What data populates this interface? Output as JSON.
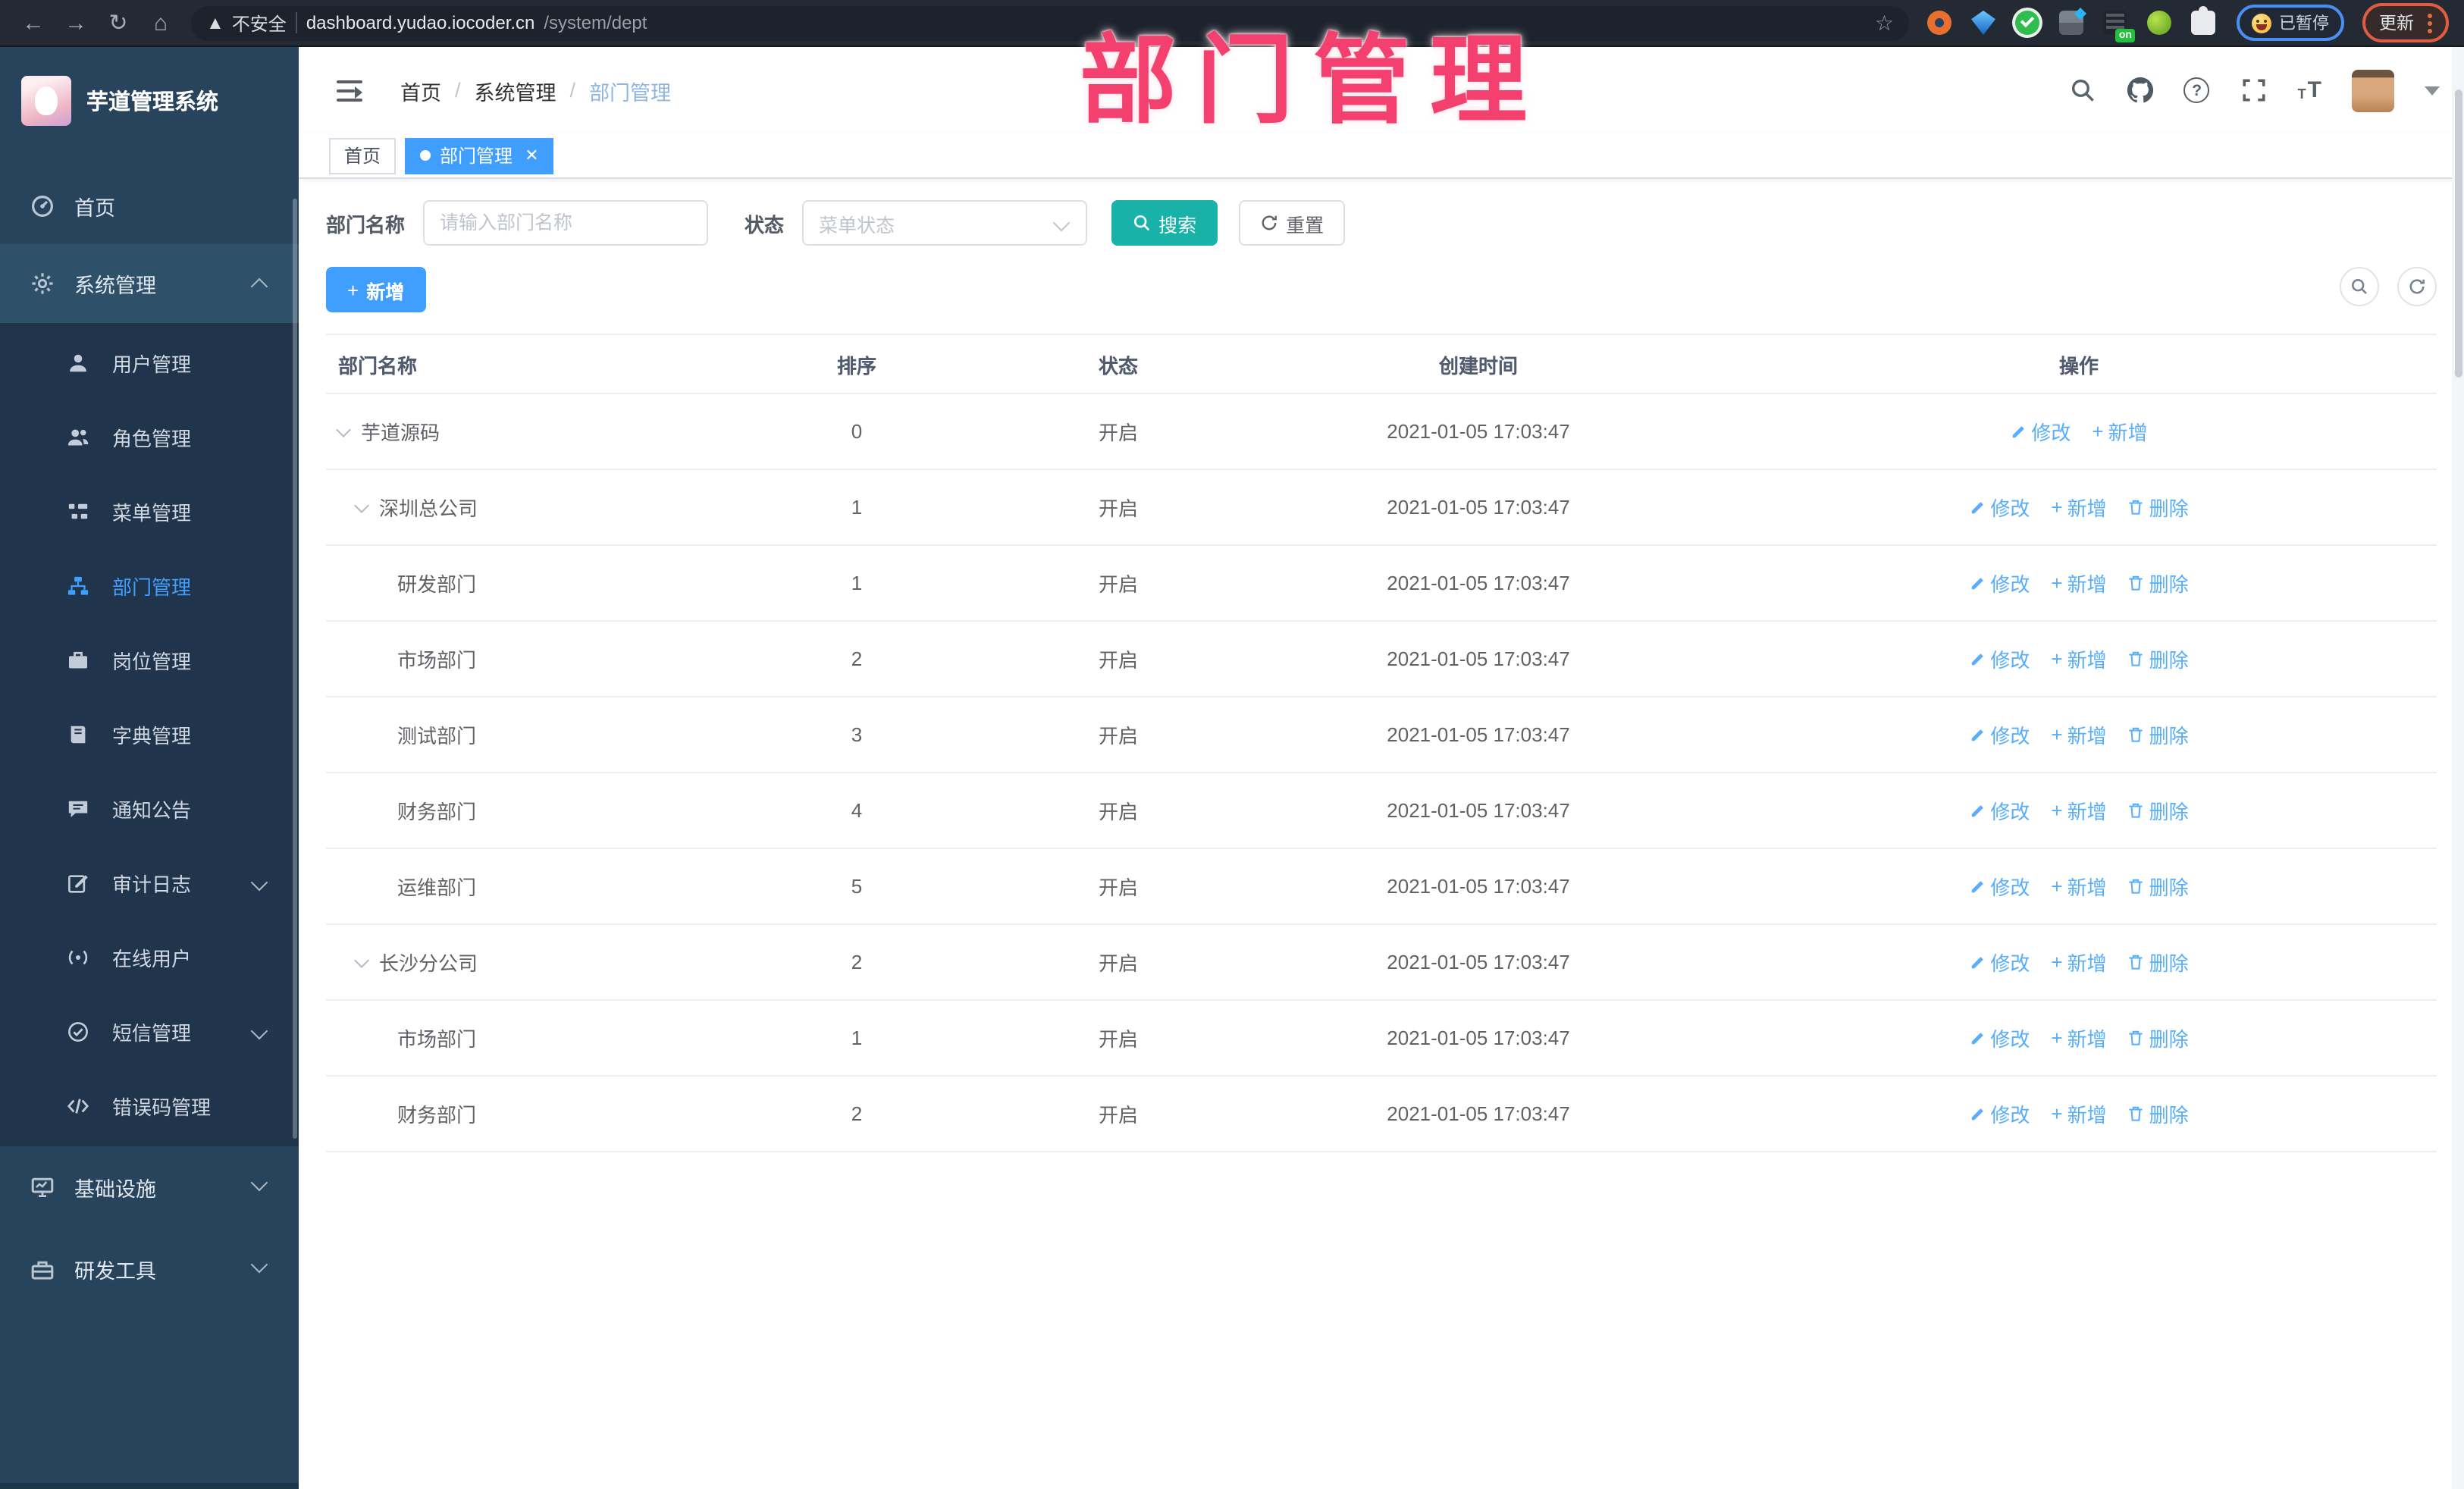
{
  "browser": {
    "security_warning": "不安全",
    "url_host": "dashboard.yudao.iocoder.cn",
    "url_path": "/system/dept",
    "extension_badge": "on",
    "paused_badge": "已暂停",
    "update_button": "更新"
  },
  "app": {
    "logo_title": "芋道管理系统",
    "overlay_title": "部门管理",
    "breadcrumb": [
      "首页",
      "系统管理",
      "部门管理"
    ],
    "tabs": [
      {
        "label": "首页",
        "active": false
      },
      {
        "label": "部门管理",
        "active": true
      }
    ]
  },
  "sidebar": {
    "items": [
      {
        "label": "首页",
        "icon": "home-icon"
      },
      {
        "label": "系统管理",
        "icon": "gear-icon",
        "state": "expanded"
      },
      {
        "label": "用户管理",
        "icon": "user-icon"
      },
      {
        "label": "角色管理",
        "icon": "users-icon"
      },
      {
        "label": "菜单管理",
        "icon": "menu-tree-icon"
      },
      {
        "label": "部门管理",
        "icon": "org-chart-icon",
        "state": "active"
      },
      {
        "label": "岗位管理",
        "icon": "briefcase-icon"
      },
      {
        "label": "字典管理",
        "icon": "dictionary-icon"
      },
      {
        "label": "通知公告",
        "icon": "announcement-icon"
      },
      {
        "label": "审计日志",
        "icon": "audit-log-icon",
        "state": "collapsed"
      },
      {
        "label": "在线用户",
        "icon": "online-user-icon"
      },
      {
        "label": "短信管理",
        "icon": "sms-icon",
        "state": "collapsed"
      },
      {
        "label": "错误码管理",
        "icon": "code-icon"
      },
      {
        "label": "基础设施",
        "icon": "infrastructure-icon",
        "state": "collapsed"
      },
      {
        "label": "研发工具",
        "icon": "toolbox-icon",
        "state": "collapsed"
      }
    ]
  },
  "filters": {
    "name_label": "部门名称",
    "name_placeholder": "请输入部门名称",
    "status_label": "状态",
    "status_placeholder": "菜单状态",
    "search_button": "搜索",
    "reset_button": "重置"
  },
  "toolbar": {
    "add_button": "新增"
  },
  "table": {
    "columns": [
      "部门名称",
      "排序",
      "状态",
      "创建时间",
      "操作"
    ],
    "action_labels": {
      "edit": "修改",
      "add": "新增",
      "del": "删除"
    },
    "rows": [
      {
        "name": "芋道源码",
        "sort": "0",
        "status": "开启",
        "created": "2021-01-05 17:03:47",
        "level": 0,
        "expandable": true,
        "deletable": false
      },
      {
        "name": "深圳总公司",
        "sort": "1",
        "status": "开启",
        "created": "2021-01-05 17:03:47",
        "level": 1,
        "expandable": true,
        "deletable": true
      },
      {
        "name": "研发部门",
        "sort": "1",
        "status": "开启",
        "created": "2021-01-05 17:03:47",
        "level": 2,
        "expandable": false,
        "deletable": true
      },
      {
        "name": "市场部门",
        "sort": "2",
        "status": "开启",
        "created": "2021-01-05 17:03:47",
        "level": 2,
        "expandable": false,
        "deletable": true
      },
      {
        "name": "测试部门",
        "sort": "3",
        "status": "开启",
        "created": "2021-01-05 17:03:47",
        "level": 2,
        "expandable": false,
        "deletable": true
      },
      {
        "name": "财务部门",
        "sort": "4",
        "status": "开启",
        "created": "2021-01-05 17:03:47",
        "level": 2,
        "expandable": false,
        "deletable": true
      },
      {
        "name": "运维部门",
        "sort": "5",
        "status": "开启",
        "created": "2021-01-05 17:03:47",
        "level": 2,
        "expandable": false,
        "deletable": true
      },
      {
        "name": "长沙分公司",
        "sort": "2",
        "status": "开启",
        "created": "2021-01-05 17:03:47",
        "level": 1,
        "expandable": true,
        "deletable": true
      },
      {
        "name": "市场部门",
        "sort": "1",
        "status": "开启",
        "created": "2021-01-05 17:03:47",
        "level": 2,
        "expandable": false,
        "deletable": true
      },
      {
        "name": "财务部门",
        "sort": "2",
        "status": "开启",
        "created": "2021-01-05 17:03:47",
        "level": 2,
        "expandable": false,
        "deletable": true
      }
    ]
  },
  "colors": {
    "accent_blue": "#409eff",
    "search_button_teal": "#18b2a8",
    "overlay_pink": "#f4406f",
    "sidebar_bg": "#28445d",
    "submenu_bg": "#20344b",
    "browser_bar_bg": "#242a34",
    "action_link_blue": "#58aefc"
  }
}
